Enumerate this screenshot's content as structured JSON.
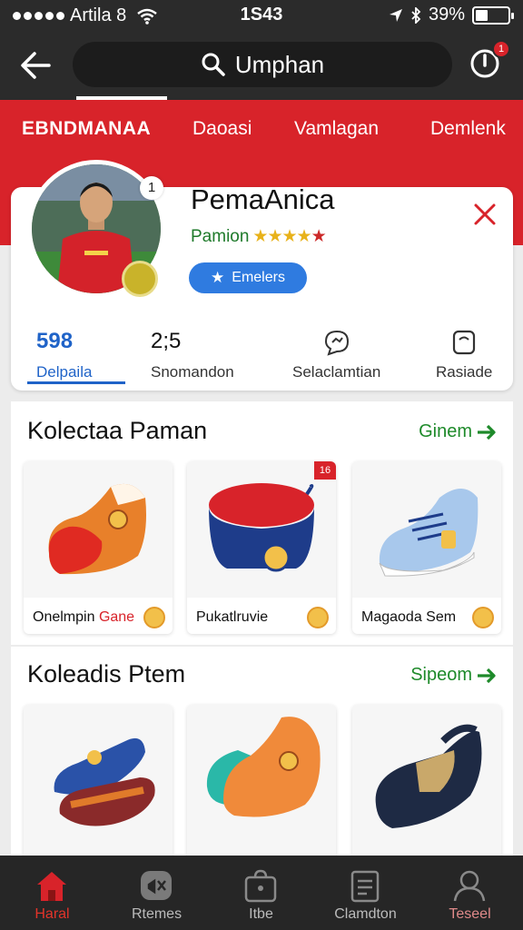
{
  "status_bar": {
    "carrier": "Artila 8",
    "time": "1S43",
    "battery": "39%",
    "battery_level": 0.39
  },
  "header": {
    "search_text": "Umphan",
    "notification_count": "1"
  },
  "tabs": {
    "brand": "EBNDMANAA",
    "items": [
      "Daoasi",
      "Vamlagan",
      "Demlenk"
    ]
  },
  "profile": {
    "name": "PemaAnica",
    "role": "Pamion",
    "rating": 4,
    "avatar_badge": "1",
    "follow_label": "Emelers"
  },
  "stats": [
    {
      "value": "598",
      "label": "Delpaila"
    },
    {
      "value": "2;5",
      "label": "Snomandon"
    },
    {
      "value": "",
      "label": "Selaclamtian"
    },
    {
      "value": "",
      "label": "Rasiade"
    }
  ],
  "section1": {
    "title": "Koleсtaa Paman",
    "link": "Ginem",
    "products": [
      {
        "label": "Onelmpin",
        "highlight": "Gane"
      },
      {
        "label": "Pukatlruvie",
        "highlight": "",
        "tag": "16"
      },
      {
        "label": "Magaoda Sem",
        "highlight": ""
      }
    ]
  },
  "section2": {
    "title": "Koleadis Ptem",
    "link": "Sipeom"
  },
  "bottom_nav": [
    {
      "label": "Haral",
      "icon": "home-icon"
    },
    {
      "label": "Rtemes",
      "icon": "mute-icon"
    },
    {
      "label": "Itbe",
      "icon": "bag-icon"
    },
    {
      "label": "Clamdton",
      "icon": "clipboard-icon"
    },
    {
      "label": "Teseel",
      "icon": "profile-icon"
    }
  ],
  "colors": {
    "accent_red": "#d8232a",
    "header_dark": "#2b2b2b",
    "link_green": "#1e8a2a",
    "active_blue": "#1f63c8"
  }
}
